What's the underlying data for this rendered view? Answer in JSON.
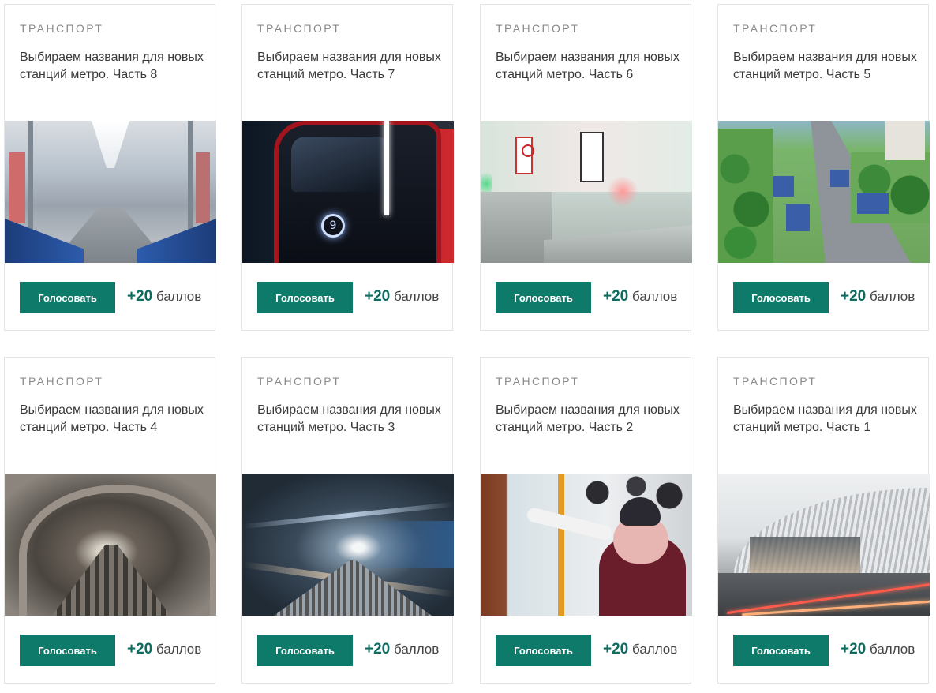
{
  "cards": [
    {
      "category": "ТРАНСПОРТ",
      "title": "Выбираем названия для новых станций метро. Часть 8",
      "button": "Голосовать",
      "points_value": "+20",
      "points_unit": "баллов"
    },
    {
      "category": "ТРАНСПОРТ",
      "title": "Выбираем названия для новых станций метро. Часть 7",
      "button": "Голосовать",
      "points_value": "+20",
      "points_unit": "баллов"
    },
    {
      "category": "ТРАНСПОРТ",
      "title": "Выбираем названия для новых станций метро. Часть 6",
      "button": "Голосовать",
      "points_value": "+20",
      "points_unit": "баллов"
    },
    {
      "category": "ТРАНСПОРТ",
      "title": "Выбираем названия для новых станций метро. Часть 5",
      "button": "Голосовать",
      "points_value": "+20",
      "points_unit": "баллов"
    },
    {
      "category": "ТРАНСПОРТ",
      "title": "Выбираем названия для новых станций метро. Часть 4",
      "button": "Голосовать",
      "points_value": "+20",
      "points_unit": "баллов"
    },
    {
      "category": "ТРАНСПОРТ",
      "title": "Выбираем названия для новых станций метро. Часть 3",
      "button": "Голосовать",
      "points_value": "+20",
      "points_unit": "баллов"
    },
    {
      "category": "ТРАНСПОРТ",
      "title": "Выбираем названия для новых станций метро. Часть 2",
      "button": "Голосовать",
      "points_value": "+20",
      "points_unit": "баллов"
    },
    {
      "category": "ТРАНСПОРТ",
      "title": "Выбираем названия для новых станций метро. Часть 1",
      "button": "Голосовать",
      "points_value": "+20",
      "points_unit": "баллов"
    }
  ],
  "colors": {
    "accent": "#0e7a6a",
    "points_accent": "#0e6b5f",
    "category_text": "#8a8a8a",
    "border": "#e4e4e4"
  },
  "photos": [
    "metro-car-interior",
    "red-metro-train-front",
    "metro-turnstiles",
    "aerial-road-with-stops",
    "metro-tunnel-tracks",
    "motion-blur-tunnel",
    "woman-at-ticket-kiosk",
    "station-canopy-render"
  ]
}
